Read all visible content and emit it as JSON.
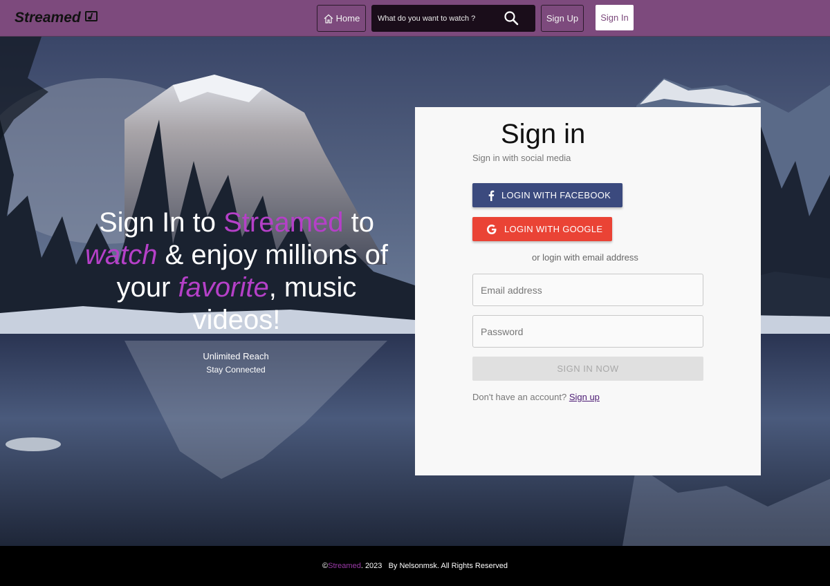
{
  "header": {
    "logo_text": "Streamed",
    "home_label": "Home",
    "search_placeholder": "What do you want to watch ?",
    "signup_label": "Sign Up",
    "signin_label": "Sign In"
  },
  "hero": {
    "line1_a": "Sign In to ",
    "line1_brand": "Streamed",
    "line1_b": " to",
    "line2_accent": "watch",
    "line2_rest": " & enjoy millions of",
    "line3_a": "your ",
    "line3_accent": "favorite",
    "line3_b": ", music",
    "line4": "videos!",
    "tagline1": "Unlimited Reach",
    "tagline2": "Stay Connected"
  },
  "card": {
    "title": "Sign in",
    "subtitle": "Sign in with social media",
    "facebook_label": "LOGIN WITH FACEBOOK",
    "google_label": "LOGIN WITH GOOGLE",
    "or_text": "or login with email address",
    "email_placeholder": "Email address",
    "password_placeholder": "Password",
    "submit_label": "SIGN IN NOW",
    "no_account_text": "Don't have an account? ",
    "signup_link": "Sign up"
  },
  "footer": {
    "copyright": "© ",
    "brand": "Streamed",
    "rest": ". 2023   By Nelsonmsk. All Rights Reserved"
  },
  "colors": {
    "header_bg": "#7d4a7d",
    "accent": "#b540c8",
    "facebook": "#3b4a7e",
    "google": "#ea4335",
    "footer_bg": "#000000"
  }
}
